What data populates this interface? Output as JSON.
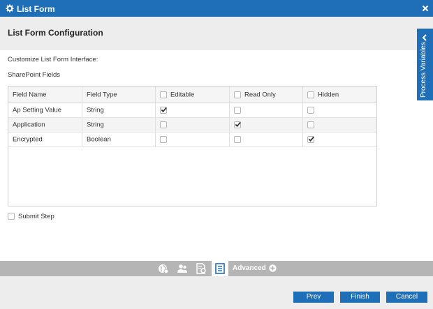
{
  "window": {
    "title": "List Form",
    "close_icon": "close-icon",
    "gear_icon": "gear-icon",
    "accent": "#1f6fb8"
  },
  "header": {
    "title": "List Form Configuration"
  },
  "side_tab": {
    "label": "Process Variables",
    "icon": "chevron-left-icon"
  },
  "main": {
    "customize_label": "Customize List Form Interface:",
    "sharepoint_label": "SharePoint Fields",
    "columns": [
      "Field Name",
      "Field Type",
      "Editable",
      "Read Only",
      "Hidden"
    ],
    "rows": [
      {
        "name": "Ap Setting Value",
        "type": "String",
        "editable": true,
        "read_only": false,
        "hidden": false
      },
      {
        "name": "Application",
        "type": "String",
        "editable": false,
        "read_only": true,
        "hidden": false
      },
      {
        "name": "Encrypted",
        "type": "Boolean",
        "editable": false,
        "read_only": false,
        "hidden": true
      }
    ],
    "submit_step": {
      "label": "Submit Step",
      "checked": false
    }
  },
  "toolbar": {
    "icons": [
      "globe-gear-icon",
      "users-icon",
      "document-settings-icon",
      "form-list-icon"
    ],
    "advanced_label": "Advanced",
    "advanced_icon": "plus-circle-icon"
  },
  "footer": {
    "prev_label": "Prev",
    "finish_label": "Finish",
    "cancel_label": "Cancel"
  }
}
